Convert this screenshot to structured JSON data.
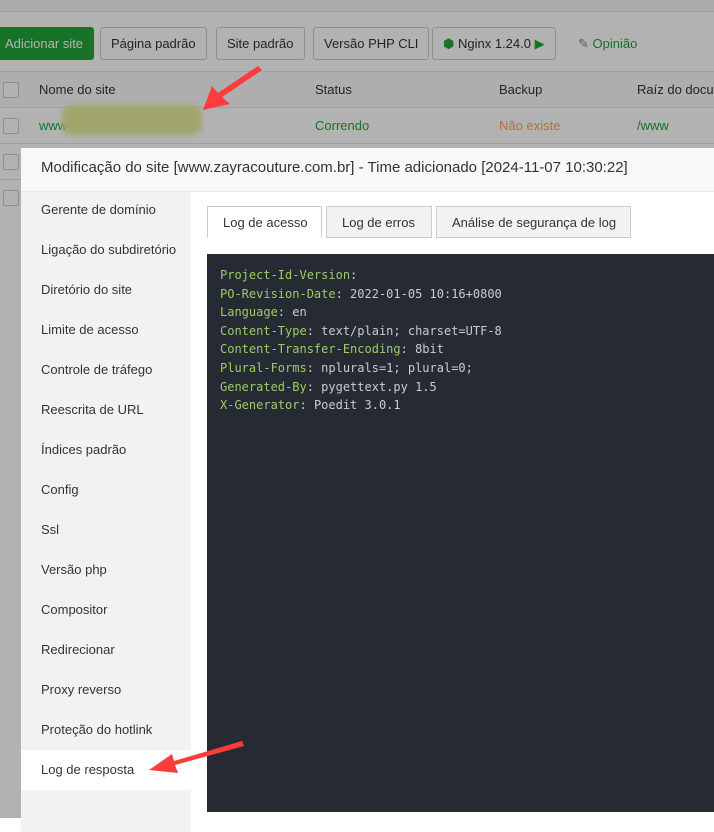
{
  "toolbar": {
    "add_site": "Adicionar site",
    "default_page": "Página padrão",
    "default_site": "Site padrão",
    "php_cli": "Versão PHP CLI",
    "nginx": "Nginx 1.24.0",
    "feedback": "Opinião"
  },
  "table": {
    "headers": [
      "Nome do site",
      "Status",
      "Backup",
      "Raíz do docu"
    ],
    "row": {
      "site": "www",
      "status": "Correndo",
      "backup": "Não existe",
      "root": "/www"
    }
  },
  "modal": {
    "title": "Modificação do site [www.zayracouture.com.br] - Time adicionado [2024-11-07 10:30:22]",
    "sidebar": [
      "Gerente de domínio",
      "Ligação do subdiretório",
      "Diretório do site",
      "Limite de acesso",
      "Controle de tráfego",
      "Reescrita de URL",
      "Índices padrão",
      "Config",
      "Ssl",
      "Versão php",
      "Compositor",
      "Redirecionar",
      "Proxy reverso",
      "Proteção do hotlink",
      "Log de resposta"
    ],
    "active_sidebar": "Log de resposta",
    "tabs": [
      "Log de acesso",
      "Log de erros",
      "Análise de segurança de log"
    ],
    "active_tab": "Log de acesso",
    "log": [
      {
        "key": "Project-Id-Version",
        "value": ""
      },
      {
        "key": "PO-Revision-Date",
        "value": "2022-01-05 10:16+0800"
      },
      {
        "key": "Language",
        "value": "en"
      },
      {
        "key": "Content-Type",
        "value": "text/plain; charset=UTF-8"
      },
      {
        "key": "Content-Transfer-Encoding",
        "value": "8bit"
      },
      {
        "key": "Plural-Forms",
        "value": "nplurals=1; plural=0;"
      },
      {
        "key": "Generated-By",
        "value": "pygettext.py 1.5"
      },
      {
        "key": "X-Generator",
        "value": "Poedit 3.0.1"
      }
    ]
  },
  "colors": {
    "accent": "#20a53a",
    "warning": "#f0ad4e",
    "log_bg": "#262a33",
    "log_key": "#9ccc65",
    "arrow": "#ff3b3b"
  }
}
